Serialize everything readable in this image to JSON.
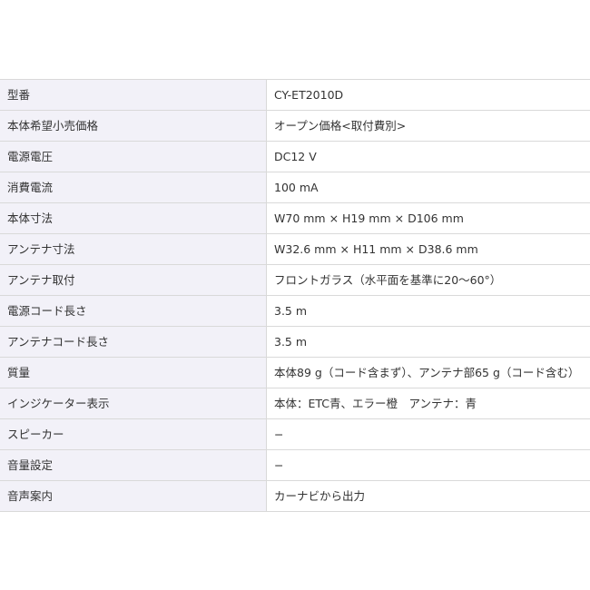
{
  "specs": [
    {
      "label": "型番",
      "value": "CY-ET2010D"
    },
    {
      "label": "本体希望小売価格",
      "value": "オープン価格<取付費別>"
    },
    {
      "label": "電源電圧",
      "value": "DC12 V"
    },
    {
      "label": "消費電流",
      "value": "100 mA"
    },
    {
      "label": "本体寸法",
      "value": "W70 mm × H19 mm × D106 mm"
    },
    {
      "label": "アンテナ寸法",
      "value": "W32.6 mm × H11 mm × D38.6 mm"
    },
    {
      "label": "アンテナ取付",
      "value": "フロントガラス（水平面を基準に20～60°）"
    },
    {
      "label": "電源コード長さ",
      "value": "3.5 m"
    },
    {
      "label": "アンテナコード長さ",
      "value": "3.5 m"
    },
    {
      "label": "質量",
      "value": "本体89 g（コード含まず）、アンテナ部65 g（コード含む）"
    },
    {
      "label": "インジケーター表示",
      "value": "本体：ETC青、エラー橙　アンテナ：青"
    },
    {
      "label": "スピーカー",
      "value": "−"
    },
    {
      "label": "音量設定",
      "value": "−"
    },
    {
      "label": "音声案内",
      "value": "カーナビから出力"
    }
  ]
}
